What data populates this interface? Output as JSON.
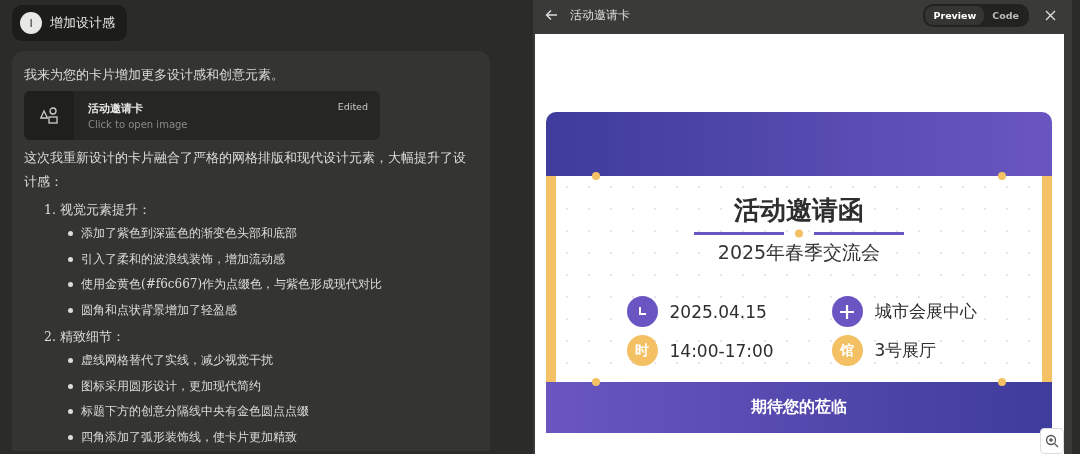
{
  "user_message": {
    "avatar": "I",
    "text": "增加设计感"
  },
  "assistant": {
    "intro": "我来为您的卡片增加更多设计感和创意元素。",
    "artifact": {
      "title": "活动邀请卡",
      "subtitle": "Click to open image",
      "status": "Edited"
    },
    "summary": "这次我重新设计的卡片融合了严格的网格排版和现代设计元素，大幅提升了设计感：",
    "sections": [
      {
        "number": "1.",
        "title": "视觉元素提升：",
        "bullets": [
          "添加了紫色到深蓝色的渐变色头部和底部",
          "引入了柔和的波浪线装饰，增加流动感",
          "使用金黄色(#f6c667)作为点缀色，与紫色形成现代对比",
          "圆角和点状背景增加了轻盈感"
        ]
      },
      {
        "number": "2.",
        "title": "精致细节：",
        "bullets": [
          "虚线网格替代了实线，减少视觉干扰",
          "图标采用圆形设计，更加现代简约",
          "标题下方的创意分隔线中央有金色圆点点缀",
          "四角添加了弧形装饰线，使卡片更加精致"
        ]
      }
    ]
  },
  "preview_panel": {
    "title": "活动邀请卡",
    "tabs": [
      {
        "label": "Preview",
        "selected": true
      },
      {
        "label": "Code",
        "selected": false
      }
    ],
    "card": {
      "title": "活动邀请函",
      "subtitle": "2025年春季交流会",
      "details": [
        {
          "kind": "clock",
          "color": "#6a56c2",
          "text": "2025.04.15"
        },
        {
          "kind": "plus",
          "color": "#6a56c2",
          "text": "城市会展中心"
        },
        {
          "kind": "glyph",
          "glyph": "时",
          "color": "#f3c063",
          "text": "14:00-17:00"
        },
        {
          "kind": "glyph",
          "glyph": "馆",
          "color": "#f3c063",
          "text": "3号展厅"
        }
      ],
      "footer": "期待您的莅临"
    }
  }
}
